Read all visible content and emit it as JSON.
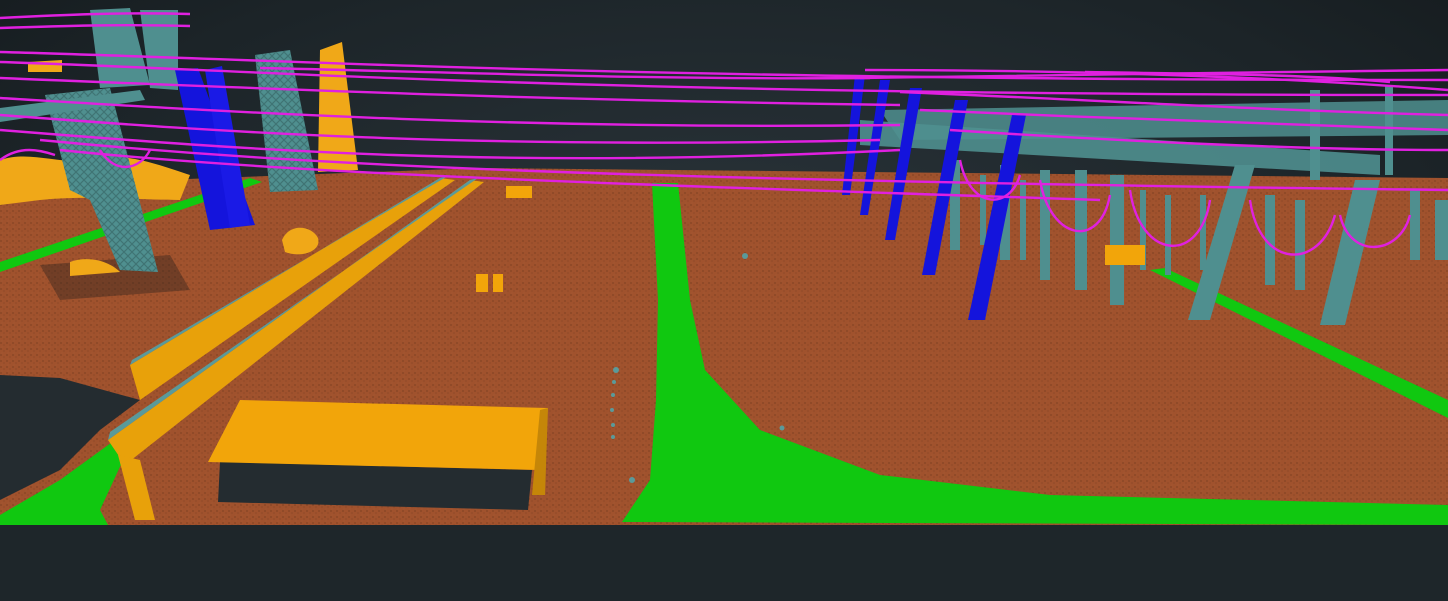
{
  "viewer": {
    "background_color": "#1d2529",
    "classes": [
      {
        "key": "ground",
        "color": "#a0522d"
      },
      {
        "key": "low_vegetation",
        "color": "#00d000"
      },
      {
        "key": "building",
        "color": "#f5a900"
      },
      {
        "key": "tower",
        "color": "#4f8f8f"
      },
      {
        "key": "pole",
        "color": "#1414dc"
      },
      {
        "key": "wire",
        "color": "#e020e0"
      },
      {
        "key": "unclassified_dark",
        "color": "#2b3338"
      }
    ]
  }
}
